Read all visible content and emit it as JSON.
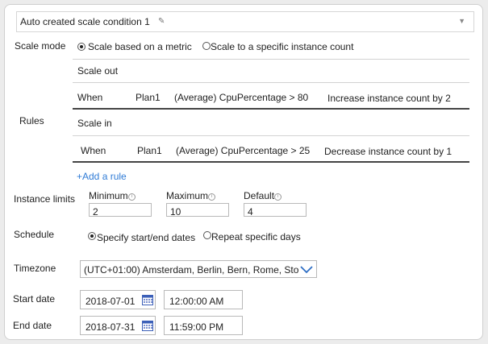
{
  "header": {
    "title": "Auto created scale condition 1",
    "pencil_icon": "pencil-icon",
    "collapse_icon": "chevron-down-icon"
  },
  "scale_mode": {
    "label": "Scale mode",
    "options": [
      {
        "label": "Scale based on a metric",
        "selected": true
      },
      {
        "label": "Scale to a specific instance count",
        "selected": false
      }
    ]
  },
  "rules": {
    "label": "Rules",
    "scale_out": {
      "heading": "Scale out",
      "when": "When",
      "resource": "Plan1",
      "condition": "(Average) CpuPercentage > 80",
      "action": "Increase instance count by 2"
    },
    "scale_in": {
      "heading": "Scale in",
      "when": "When",
      "resource": "Plan1",
      "condition": "(Average) CpuPercentage > 25",
      "action": "Decrease instance count by 1"
    },
    "add_rule": "+Add a rule"
  },
  "instance_limits": {
    "label": "Instance limits",
    "minimum": {
      "label": "Minimum",
      "value": "2"
    },
    "maximum": {
      "label": "Maximum",
      "value": "10"
    },
    "default": {
      "label": "Default",
      "value": "4"
    }
  },
  "schedule": {
    "label": "Schedule",
    "options": [
      {
        "label": "Specify start/end dates",
        "selected": true
      },
      {
        "label": "Repeat specific days",
        "selected": false
      }
    ]
  },
  "timezone": {
    "label": "Timezone",
    "value": "(UTC+01:00) Amsterdam, Berlin, Bern, Rome, Sto"
  },
  "start_date": {
    "label": "Start date",
    "date": "2018-07-01",
    "time": "12:00:00 AM"
  },
  "end_date": {
    "label": "End date",
    "date": "2018-07-31",
    "time": "11:59:00 PM"
  },
  "colors": {
    "link": "#2f7bd6",
    "border": "#b9b9b9",
    "separator": "#444444"
  }
}
